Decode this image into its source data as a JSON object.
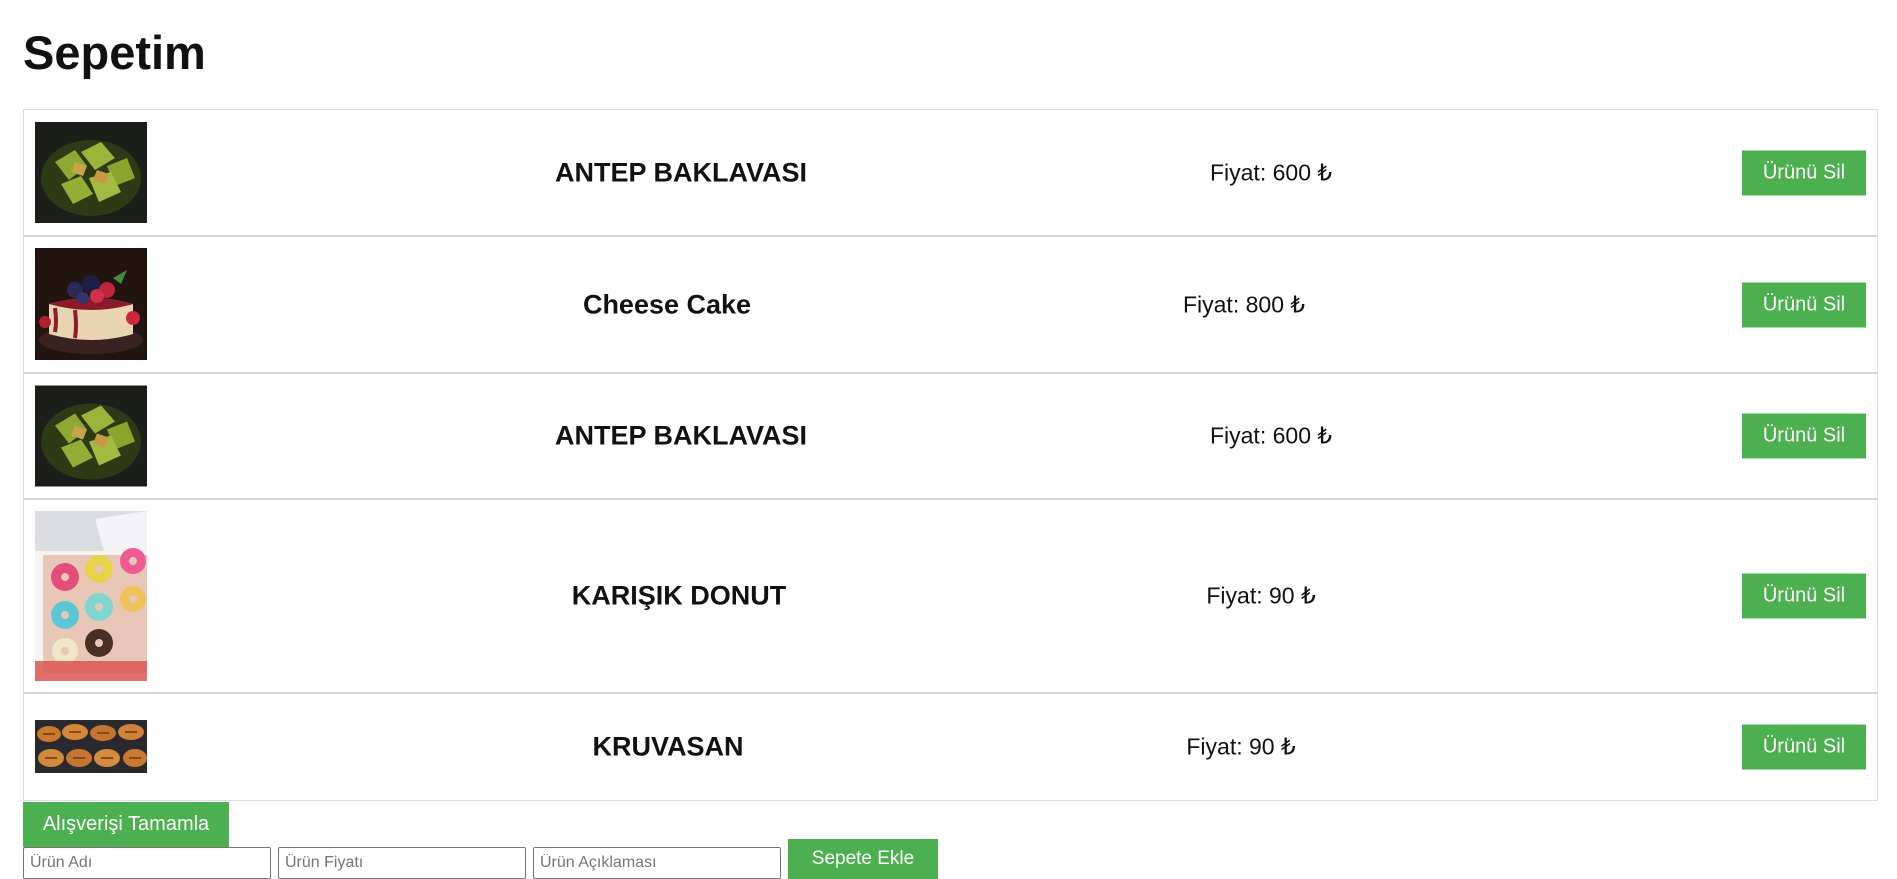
{
  "page": {
    "title": "Sepetim"
  },
  "cart": {
    "items": [
      {
        "name": "ANTEP BAKLAVASI",
        "price": "Fiyat: 600 ₺",
        "image": "baklava-photo",
        "remove_label": "Ürünü Sil"
      },
      {
        "name": "Cheese Cake",
        "price": "Fiyat: 800 ₺",
        "image": "cheesecake-photo",
        "remove_label": "Ürünü Sil"
      },
      {
        "name": "ANTEP BAKLAVASI",
        "price": "Fiyat: 600 ₺",
        "image": "baklava-photo",
        "remove_label": "Ürünü Sil"
      },
      {
        "name": "KARIŞIK DONUT",
        "price": "Fiyat: 90 ₺",
        "image": "donut-box-photo",
        "remove_label": "Ürünü Sil"
      },
      {
        "name": "KRUVASAN",
        "price": "Fiyat: 90 ₺",
        "image": "croissant-photo",
        "remove_label": "Ürünü Sil"
      }
    ],
    "complete_label": "Alışverişi Tamamla"
  },
  "add_form": {
    "name_placeholder": "Ürün Adı",
    "price_placeholder": "Ürün Fiyatı",
    "desc_placeholder": "Ürün Açıklaması",
    "submit_label": "Sepete Ekle"
  },
  "colors": {
    "button_green": "#4caf50",
    "row_border": "#d6d6d6"
  }
}
